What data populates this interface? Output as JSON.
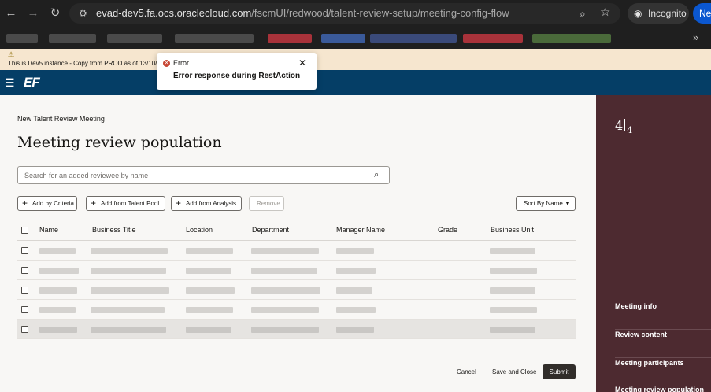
{
  "browser": {
    "url_host": "evad-dev5.fa.ocs.oraclecloud.com",
    "url_path": "/fscmUI/redwood/talent-review-setup/meeting-config-flow",
    "incognito_label": "Incognito",
    "new_label": "New"
  },
  "banner": {
    "warning_icon": "⚠",
    "text": "This is Dev5 instance - Copy from PROD as of 13/10/20"
  },
  "app": {
    "logo": "EF"
  },
  "toast": {
    "title": "Error",
    "message": "Error response during RestAction"
  },
  "main": {
    "breadcrumb": "New Talent Review Meeting",
    "title": "Meeting review population",
    "search_placeholder": "Search for an added reviewee by name",
    "buttons": {
      "add_by_criteria": "Add by Criteria",
      "add_from_pool": "Add from Talent Pool",
      "add_from_analysis": "Add from Analysis",
      "remove": "Remove",
      "sort": "Sort By Name"
    },
    "columns": [
      "Name",
      "Business Title",
      "Location",
      "Department",
      "Manager Name",
      "Grade",
      "Business Unit"
    ],
    "footer": {
      "cancel": "Cancel",
      "save_close": "Save and Close",
      "submit": "Submit"
    }
  },
  "side": {
    "step_current": "4",
    "step_total": "4",
    "items": [
      "Meeting info",
      "Review content",
      "Meeting participants",
      "Meeting review population"
    ]
  },
  "colors": {
    "header": "#053e66",
    "side_panel": "#4d2a30",
    "banner": "#f6e6cf",
    "error": "#c74634",
    "submit": "#312d2a"
  }
}
